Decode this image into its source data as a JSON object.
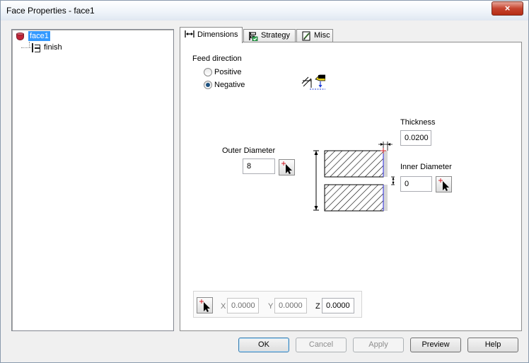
{
  "window": {
    "title": "Face Properties - face1",
    "close_icon": "×"
  },
  "tree": {
    "items": [
      {
        "label": "face1",
        "icon": "database-icon",
        "selected": true
      },
      {
        "label": "finish",
        "icon": "toolpath-icon",
        "selected": false
      }
    ]
  },
  "tabs": [
    {
      "label": "Dimensions",
      "icon": "dimensions-icon",
      "active": true
    },
    {
      "label": "Strategy",
      "icon": "strategy-icon",
      "active": false
    },
    {
      "label": "Misc",
      "icon": "misc-icon",
      "active": false
    }
  ],
  "dimensions": {
    "feed_direction": {
      "label": "Feed direction",
      "options": [
        {
          "label": "Positive",
          "checked": false
        },
        {
          "label": "Negative",
          "checked": true
        }
      ]
    },
    "thickness": {
      "label": "Thickness",
      "value": "0.0200"
    },
    "outer_diameter": {
      "label": "Outer Diameter",
      "value": "8"
    },
    "inner_diameter": {
      "label": "Inner Diameter",
      "value": "0"
    },
    "coords": {
      "x_label": "X",
      "x_value": "0.0000",
      "y_label": "Y",
      "y_value": "0.0000",
      "z_label": "Z",
      "z_value": "0.0000"
    }
  },
  "buttons": {
    "ok": "OK",
    "cancel": "Cancel",
    "apply": "Apply",
    "preview": "Preview",
    "help": "Help"
  },
  "colors": {
    "selection": "#3399ff",
    "close_red": "#c6442f",
    "default_button_border": "#3c7fb1"
  }
}
